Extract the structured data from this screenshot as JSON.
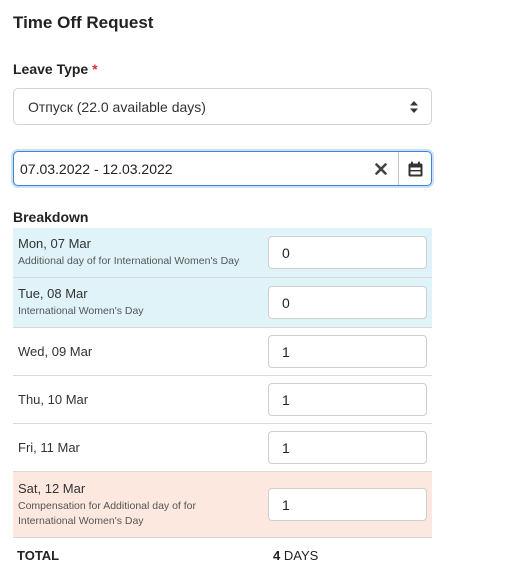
{
  "form": {
    "title": "Time Off Request",
    "leave_type_label": "Leave Type",
    "required_mark": "*",
    "leave_type_value": "Отпуск (22.0 available days)",
    "date_range_value": "07.03.2022 - 12.03.2022",
    "breakdown_label": "Breakdown"
  },
  "breakdown": {
    "rows": [
      {
        "day": "Mon, 07 Mar",
        "note": "Additional day of for International Women's Day",
        "value": "0",
        "highlight": "holiday"
      },
      {
        "day": "Tue, 08 Mar",
        "note": "International Women's Day",
        "value": "0",
        "highlight": "holiday"
      },
      {
        "day": "Wed, 09 Mar",
        "note": "",
        "value": "1",
        "highlight": "none"
      },
      {
        "day": "Thu, 10 Mar",
        "note": "",
        "value": "1",
        "highlight": "none"
      },
      {
        "day": "Fri, 11 Mar",
        "note": "",
        "value": "1",
        "highlight": "none"
      },
      {
        "day": "Sat, 12 Mar",
        "note": "Compensation for Additional day of for International Women's Day",
        "value": "1",
        "highlight": "compensation"
      }
    ]
  },
  "total": {
    "label": "TOTAL",
    "count": "4",
    "unit": "DAYS"
  },
  "colors": {
    "holiday_row": "#dff3f9",
    "compensation_row": "#fde8e0",
    "focus_border": "#3a85d6",
    "required": "#d9322e"
  },
  "icons": {
    "select_arrows": "sort-icon",
    "clear": "times-icon",
    "calendar": "calendar-icon"
  }
}
